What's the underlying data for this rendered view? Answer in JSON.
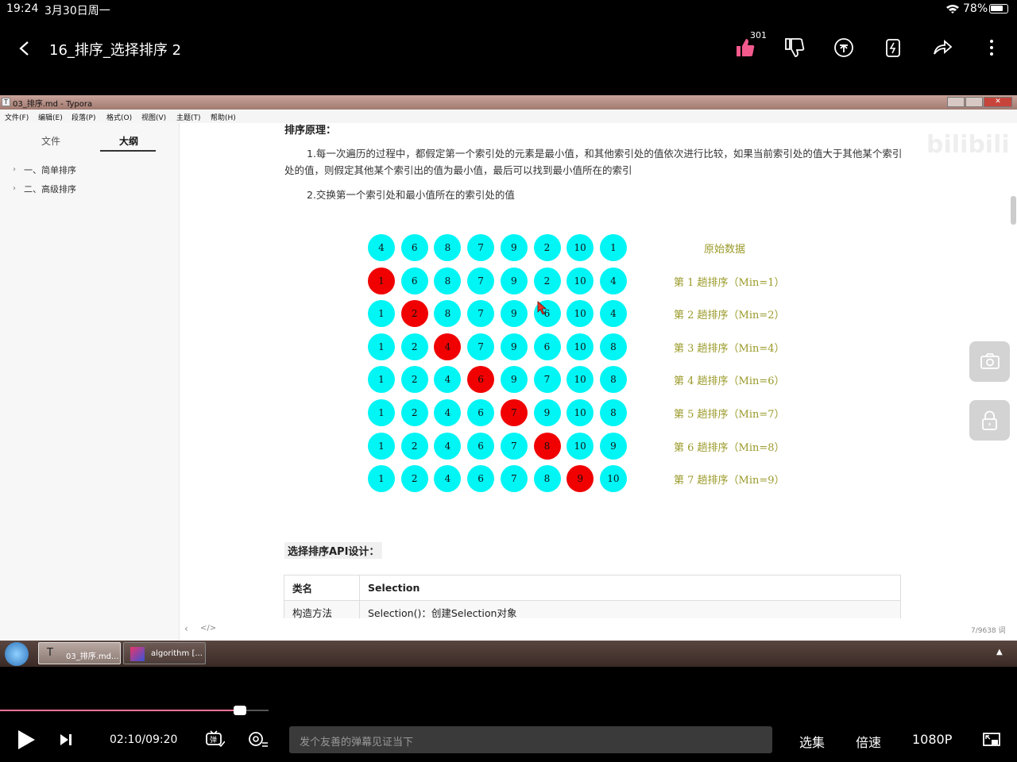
{
  "status_bar": {
    "time": "19:24",
    "date": "3月30日周一",
    "battery": "78%"
  },
  "top_bar": {
    "title": "16_排序_选择排序 2",
    "like_count": "301"
  },
  "typora": {
    "window_title": "03_排序.md - Typora",
    "menu": [
      "文件(F)",
      "编辑(E)",
      "段落(P)",
      "格式(O)",
      "视图(V)",
      "主题(T)",
      "帮助(H)"
    ],
    "sidebar_tabs": [
      "文件",
      "大纲"
    ],
    "outline": [
      "一、简单排序",
      "二、高级排序"
    ],
    "heading": "排序原理：",
    "para1": "1.每一次遍历的过程中，都假定第一个索引处的元素是最小值，和其他索引处的值依次进行比较，如果当前索引处的值大于其他某个索引处的值，则假定其他某个索引出的值为最小值，最后可以找到最小值所在的索引",
    "para2": "2.交换第一个索引处和最小值所在的索引处的值",
    "api_heading": "选择排序API设计：",
    "api_table": {
      "rows": [
        [
          "类名",
          "Selection"
        ],
        [
          "构造方法",
          "Selection()：创建Selection对象"
        ]
      ]
    },
    "word_count": "7/9638 词",
    "watermark": "bilibili"
  },
  "chart_data": {
    "type": "table",
    "rows": [
      {
        "label": "原始数据",
        "values": [
          4,
          6,
          8,
          7,
          9,
          2,
          10,
          1
        ],
        "highlight": null
      },
      {
        "label": "第 1 趟排序（Min=1）",
        "values": [
          1,
          6,
          8,
          7,
          9,
          2,
          10,
          4
        ],
        "highlight": 0
      },
      {
        "label": "第 2 趟排序（Min=2）",
        "values": [
          1,
          2,
          8,
          7,
          9,
          6,
          10,
          4
        ],
        "highlight": 1
      },
      {
        "label": "第 3 趟排序（Min=4）",
        "values": [
          1,
          2,
          4,
          7,
          9,
          6,
          10,
          8
        ],
        "highlight": 2
      },
      {
        "label": "第 4 趟排序（Min=6）",
        "values": [
          1,
          2,
          4,
          6,
          9,
          7,
          10,
          8
        ],
        "highlight": 3
      },
      {
        "label": "第 5 趟排序（Min=7）",
        "values": [
          1,
          2,
          4,
          6,
          7,
          9,
          10,
          8
        ],
        "highlight": 4
      },
      {
        "label": "第 6 趟排序（Min=8）",
        "values": [
          1,
          2,
          4,
          6,
          7,
          8,
          10,
          9
        ],
        "highlight": 5
      },
      {
        "label": "第 7 趟排序（Min=9）",
        "values": [
          1,
          2,
          4,
          6,
          7,
          8,
          9,
          10
        ],
        "highlight": 6
      }
    ],
    "colors": {
      "normal": "#00f5f5",
      "min": "#f00000",
      "label": "#9a9a2a"
    }
  },
  "taskbar": {
    "items": [
      "03_排序.md...",
      "algorithm [..."
    ]
  },
  "player": {
    "time": "02:10/09:20",
    "progress": 0.236,
    "danmaku_placeholder": "发个友善的弹幕见证当下",
    "episodes": "选集",
    "speed": "倍速",
    "quality": "1080P"
  }
}
